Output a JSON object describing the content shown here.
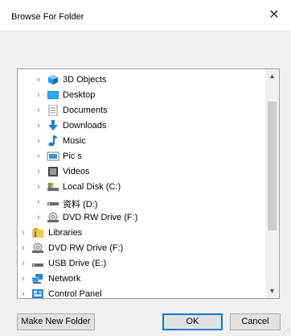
{
  "window": {
    "title": "Browse For Folder",
    "close_glyph": "✕"
  },
  "tree": {
    "items": [
      {
        "label": "3D Objects",
        "icon": "3d-objects-icon"
      },
      {
        "label": "Desktop",
        "icon": "desktop-icon"
      },
      {
        "label": "Documents",
        "icon": "documents-icon"
      },
      {
        "label": "Downloads",
        "icon": "downloads-icon"
      },
      {
        "label": "Music",
        "icon": "music-icon"
      },
      {
        "label": "Pic     s",
        "icon": "pictures-icon"
      },
      {
        "label": "Videos",
        "icon": "videos-icon"
      },
      {
        "label": "Local Disk (C:)",
        "icon": "local-disk-icon"
      },
      {
        "label": "资料 (D:)",
        "icon": "drive-icon"
      },
      {
        "label": "DVD RW Drive (F:)",
        "icon": "dvd-drive-icon"
      },
      {
        "label": "Libraries",
        "icon": "libraries-icon"
      },
      {
        "label": "DVD RW Drive (F:)",
        "icon": "dvd-drive-icon"
      },
      {
        "label": "USB Drive (E:)",
        "icon": "usb-drive-icon"
      },
      {
        "label": "Network",
        "icon": "network-icon"
      },
      {
        "label": "Control Panel",
        "icon": "control-panel-icon"
      }
    ],
    "chevron_glyph": "›",
    "scroll_up_glyph": "▲",
    "scroll_down_glyph": "▼"
  },
  "buttons": {
    "make_new_folder": "Make New Folder",
    "ok": "OK",
    "cancel": "Cancel"
  },
  "colors": {
    "accent": "#0078d7"
  }
}
